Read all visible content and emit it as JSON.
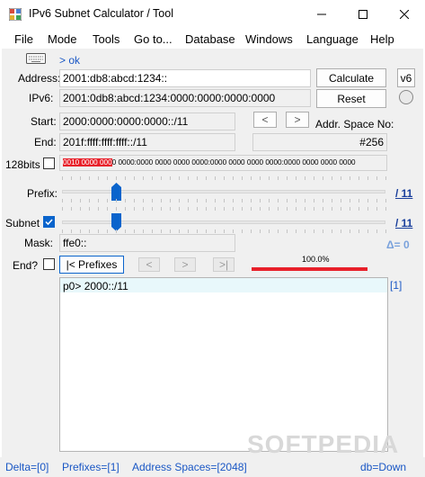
{
  "window": {
    "title": "IPv6 Subnet Calculator / Tool"
  },
  "menu": [
    "File",
    "Mode",
    "Tools",
    "Go to...",
    "Database",
    "Windows",
    "Language",
    "Help"
  ],
  "form": {
    "ok_link": "> ok",
    "address_label": "Address:",
    "address_value": "2001:db8:abcd:1234::",
    "ipv6_label": "IPv6:",
    "ipv6_value": "2001:0db8:abcd:1234:0000:0000:0000:0000",
    "calculate_label": "Calculate",
    "reset_label": "Reset",
    "v6_label": "v6",
    "start_label": "Start:",
    "start_value": "2000:0000:0000:0000::/11",
    "end_label": "End:",
    "end_value": "201f:ffff:ffff:ffff::/11",
    "nav_prev": "<",
    "nav_next": ">",
    "addr_space_label": "Addr. Space No:",
    "addr_space_value": "#256",
    "bits_label": "128bits",
    "bits_highlight": "0010 0000 000",
    "bits_rest": "0 0000:0000 0000 0000 0000:0000 0000 0000 0000:0000 0000 0000 0000",
    "prefix_label": "Prefix:",
    "prefix_value": "/ 11",
    "subnet_label": "Subnet",
    "subnet_value": "/ 11",
    "mask_label": "Mask:",
    "mask_value": "ffe0::",
    "delta_value": "Δ= 0",
    "end_q_label": "End?",
    "prefixes_button": "|< Prefixes",
    "prev_button": "<",
    "next_button": ">",
    "last_button": ">|",
    "progress_text": "100.0%",
    "progress": 1.0
  },
  "results": {
    "lines": [
      "p0> 2000::/11"
    ],
    "count_label": "[1]"
  },
  "status": {
    "delta": "Delta=[0]",
    "prefixes": "Prefixes=[1]",
    "address_spaces": "Address Spaces=[2048]",
    "db": "db=Down"
  },
  "watermark": "SOFTPEDIA",
  "colors": {
    "accent": "#0a64cc",
    "highlight": "#e8202a",
    "link": "#1a57c5"
  }
}
